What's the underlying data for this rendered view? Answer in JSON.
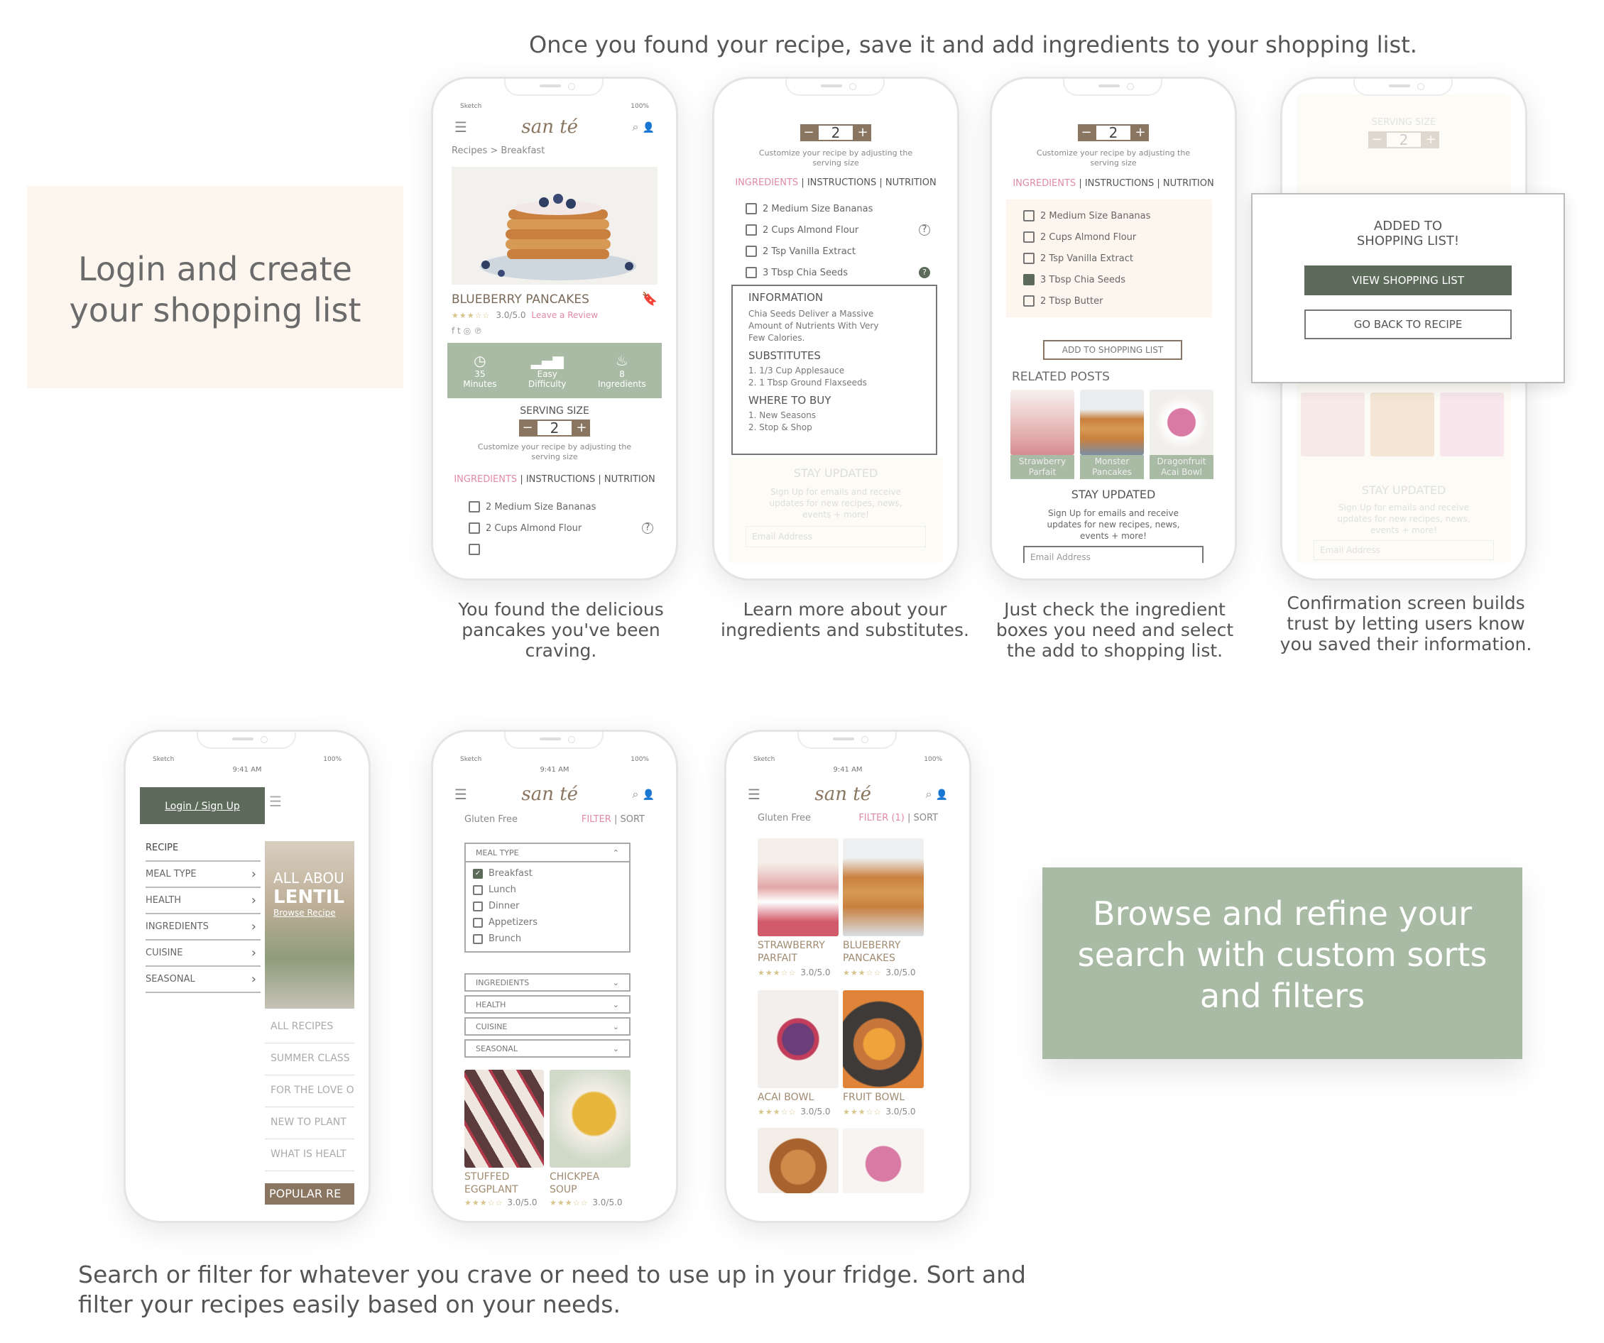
{
  "headline": "Once you found your recipe, save it and add ingredients to your shopping list.",
  "login_box": {
    "line1": "Login and create",
    "line2": "your shopping list"
  },
  "browse_box": {
    "line1": "Browse and refine your",
    "line2": "search with custom sorts",
    "line3": "and filters"
  },
  "bottom_caption": {
    "line1": "Search or filter for whatever you crave or need to use up in your fridge. Sort and",
    "line2": "filter your recipes easily based on your needs."
  },
  "captions": [
    {
      "l1": "You found the delicious",
      "l2": "pancakes you've been",
      "l3": "craving."
    },
    {
      "l1": "Learn more about your",
      "l2": "ingredients and substitutes.",
      "l3": ""
    },
    {
      "l1": "Just check the ingredient",
      "l2": "boxes you need and select",
      "l3": "the add to shopping list."
    },
    {
      "l1": "Confirmation screen builds",
      "l2": "trust by letting users know",
      "l3": "you saved their information."
    }
  ],
  "status": {
    "carrier": "Sketch",
    "time": "9:41 AM",
    "battery": "100%"
  },
  "brand": {
    "logo": "san té"
  },
  "colors": {
    "sage": "#a9bba5",
    "dark_green": "#5c6b5a",
    "pink": "#e08aa6",
    "brown": "#8a7560",
    "cream": "#fdf6ee"
  },
  "recipe": {
    "breadcrumb_root": "Recipes",
    "breadcrumb_sep": ">",
    "breadcrumb_leaf": "Breakfast",
    "title": "BLUEBERRY PANCAKES",
    "rating": "3.0/5.0",
    "review_link": "Leave a Review",
    "stats": [
      {
        "value": "35",
        "label": "Minutes"
      },
      {
        "value": "Easy",
        "label": "Difficulty"
      },
      {
        "value": "8",
        "label": "Ingredients"
      }
    ],
    "serving_label": "SERVING SIZE",
    "serving_value": "2",
    "serving_hint_1": "Customize your recipe by adjusting the",
    "serving_hint_2": "serving size",
    "tab_ingredients": "INGREDIENTS",
    "tab_instructions": "INSTRUCTIONS",
    "tab_nutrition": "NUTRITION",
    "tab_sep": "|"
  },
  "ingredients": [
    "2 Medium Size Bananas",
    "2 Cups Almond Flour",
    "2 Tsp Vanilla Extract",
    "3 Tbsp Chia Seeds",
    "2 Tbsp Butter"
  ],
  "info_panel": {
    "title": "INFORMATION",
    "text1": "Chia Seeds Deliver a Massive",
    "text2": "Amount of Nutrients With Very",
    "text3": "Few Calories.",
    "subs_title": "SUBSTITUTES",
    "sub1": "1. 1/3 Cup Applesauce",
    "sub2": "2. 1 Tbsp Ground Flaxseeds",
    "buy_title": "WHERE TO BUY",
    "buy1": "1. New Seasons",
    "buy2": "2. Stop & Shop"
  },
  "add_button": "ADD TO SHOPPING LIST",
  "related": {
    "title": "RELATED POSTS",
    "items": [
      {
        "l1": "Strawberry",
        "l2": "Parfait"
      },
      {
        "l1": "Monster",
        "l2": "Pancakes"
      },
      {
        "l1": "Dragonfruit",
        "l2": "Acai Bowl"
      }
    ]
  },
  "newsletter": {
    "title": "STAY UPDATED",
    "text1": "Sign Up for emails and receive",
    "text2": "updates for new recipes, news,",
    "text3": "events + more!",
    "placeholder": "Email Address"
  },
  "modal": {
    "line1": "ADDED TO",
    "line2": "SHOPPING LIST!",
    "primary": "VIEW SHOPPING LIST",
    "secondary": "GO BACK TO RECIPE"
  },
  "menu": {
    "login": "Login / Sign Up",
    "section": "RECIPE",
    "items": [
      "MEAL TYPE",
      "HEALTH",
      "INGREDIENTS",
      "CUISINE",
      "SEASONAL"
    ],
    "hero_1": "ALL ABOU",
    "hero_2": "LENTIL",
    "hero_link": "Browse Recipe",
    "links": [
      "ALL RECIPES",
      "SUMMER CLASS",
      "FOR THE LOVE O",
      "NEW TO PLANT",
      "WHAT IS HEALT"
    ],
    "popular": "POPULAR RE"
  },
  "filter": {
    "gluten": "Gluten Free",
    "filter": "FILTER",
    "filter_active": "FILTER (1)",
    "sort": "SORT",
    "meal_type": "MEAL TYPE",
    "options": [
      "Breakfast",
      "Lunch",
      "Dinner",
      "Appetizers",
      "Brunch"
    ],
    "groups": [
      "INGREDIENTS",
      "HEALTH",
      "CUISINE",
      "SEASONAL"
    ],
    "cards": [
      {
        "l1": "STUFFED",
        "l2": "EGGPLANT",
        "rating": "3.0/5.0"
      },
      {
        "l1": "CHICKPEA",
        "l2": "SOUP",
        "rating": "3.0/5.0"
      }
    ]
  },
  "results": {
    "cards": [
      {
        "l1": "STRAWBERRY",
        "l2": "PARFAIT",
        "rating": "3.0/5.0"
      },
      {
        "l1": "BLUEBERRY",
        "l2": "PANCAKES",
        "rating": "3.0/5.0"
      },
      {
        "l1": "ACAI BOWL",
        "l2": "",
        "rating": "3.0/5.0"
      },
      {
        "l1": "FRUIT BOWL",
        "l2": "",
        "rating": "3.0/5.0"
      }
    ]
  }
}
